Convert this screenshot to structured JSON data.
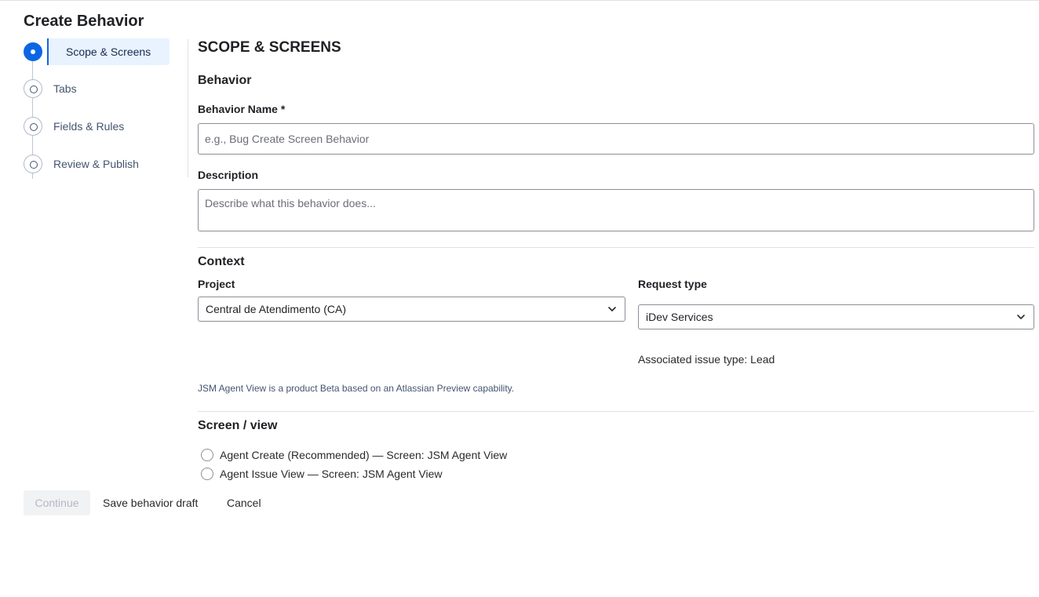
{
  "page": {
    "title": "Create Behavior"
  },
  "stepper": {
    "steps": [
      {
        "label": "Scope & Screens",
        "state": "current"
      },
      {
        "label": "Tabs",
        "state": "pending"
      },
      {
        "label": "Fields & Rules",
        "state": "pending"
      },
      {
        "label": "Review & Publish",
        "state": "pending"
      }
    ]
  },
  "main": {
    "section_title": "SCOPE & SCREENS",
    "behavior": {
      "heading": "Behavior",
      "name_label": "Behavior Name *",
      "name_value": "",
      "name_placeholder": "e.g., Bug Create Screen Behavior",
      "description_label": "Description",
      "description_value": "",
      "description_placeholder": "Describe what this behavior does..."
    },
    "context": {
      "heading": "Context",
      "project_label": "Project",
      "project_value": "Central de Atendimento (CA)",
      "request_type_label": "Request type",
      "request_type_value": "iDev Services",
      "associated_issue_type": "Associated issue type: Lead",
      "beta_note": "JSM Agent View is a product Beta based on an Atlassian Preview capability."
    },
    "screen_view": {
      "heading": "Screen / view",
      "options": [
        {
          "label": "Agent Create (Recommended) — Screen: JSM Agent View",
          "selected": false
        },
        {
          "label": "Agent Issue View — Screen: JSM Agent View",
          "selected": false
        }
      ]
    }
  },
  "footer": {
    "continue_label": "Continue",
    "continue_disabled": true,
    "save_draft_label": "Save behavior draft",
    "cancel_label": "Cancel"
  },
  "colors": {
    "accent": "#0c66e4",
    "selected_step_bg": "#e9f2ff",
    "border": "#8c8f97"
  },
  "icons": {
    "select_chevron": "chevron-down-icon",
    "step_marker": "step-circle-icon"
  }
}
